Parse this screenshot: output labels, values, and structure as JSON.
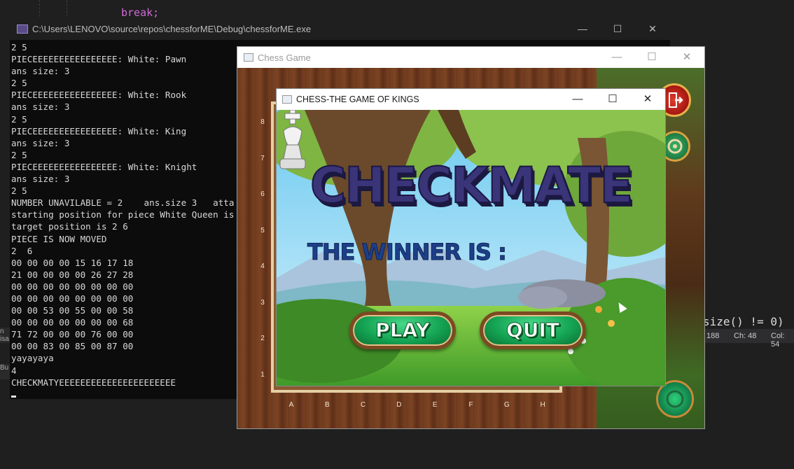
{
  "ide": {
    "code_top": "break;",
    "code_right": "size() != 0)",
    "status_line": "188",
    "status_ch": "Ch: 48",
    "status_col": "Col: 54",
    "left_label_top": "n isa",
    "left_label_bottom": "Bu"
  },
  "console": {
    "title": "C:\\Users\\LENOVO\\source\\repos\\chessforME\\Debug\\chessforME.exe",
    "lines": [
      "2 5",
      "PIECEEEEEEEEEEEEEEEE: White: Pawn",
      "ans size: 3",
      "2 5",
      "PIECEEEEEEEEEEEEEEEE: White: Rook",
      "ans size: 3",
      "2 5",
      "PIECEEEEEEEEEEEEEEEE: White: King",
      "ans size: 3",
      "2 5",
      "PIECEEEEEEEEEEEEEEEE: White: Knight",
      "ans size: 3",
      "2 5",
      "NUMBER UNAVILABLE = 2    ans.size 3   atta",
      "starting position for piece White Queen is",
      "target position is 2 6",
      "PIECE IS NOW MOVED",
      "2  6",
      "00 00 00 00 15 16 17 18",
      "21 00 00 00 00 26 27 28",
      "00 00 00 00 00 00 00 00",
      "00 00 00 00 00 00 00 00",
      "00 00 53 00 55 00 00 58",
      "00 00 00 00 00 00 00 68",
      "71 72 00 00 00 76 00 00",
      "00 00 83 00 85 00 87 00",
      "yayayaya",
      "4",
      "CHECKMATYEEEEEEEEEEEEEEEEEEEEEE"
    ]
  },
  "game_window": {
    "title": "Chess Game",
    "ranks": [
      "8",
      "7",
      "6",
      "5",
      "4",
      "3",
      "2",
      "1"
    ],
    "files": [
      "A",
      "B",
      "C",
      "D",
      "E",
      "F",
      "G",
      "H"
    ]
  },
  "popup": {
    "title": "CHESS-THE GAME OF KINGS",
    "headline": "CHECKMATE",
    "winner_text": "THE WINNER IS :",
    "winner_piece": "white-king-icon",
    "play_label": "PLAY",
    "quit_label": "QUIT"
  },
  "window_controls": {
    "minimize": "—",
    "maximize": "☐",
    "close": "✕"
  }
}
